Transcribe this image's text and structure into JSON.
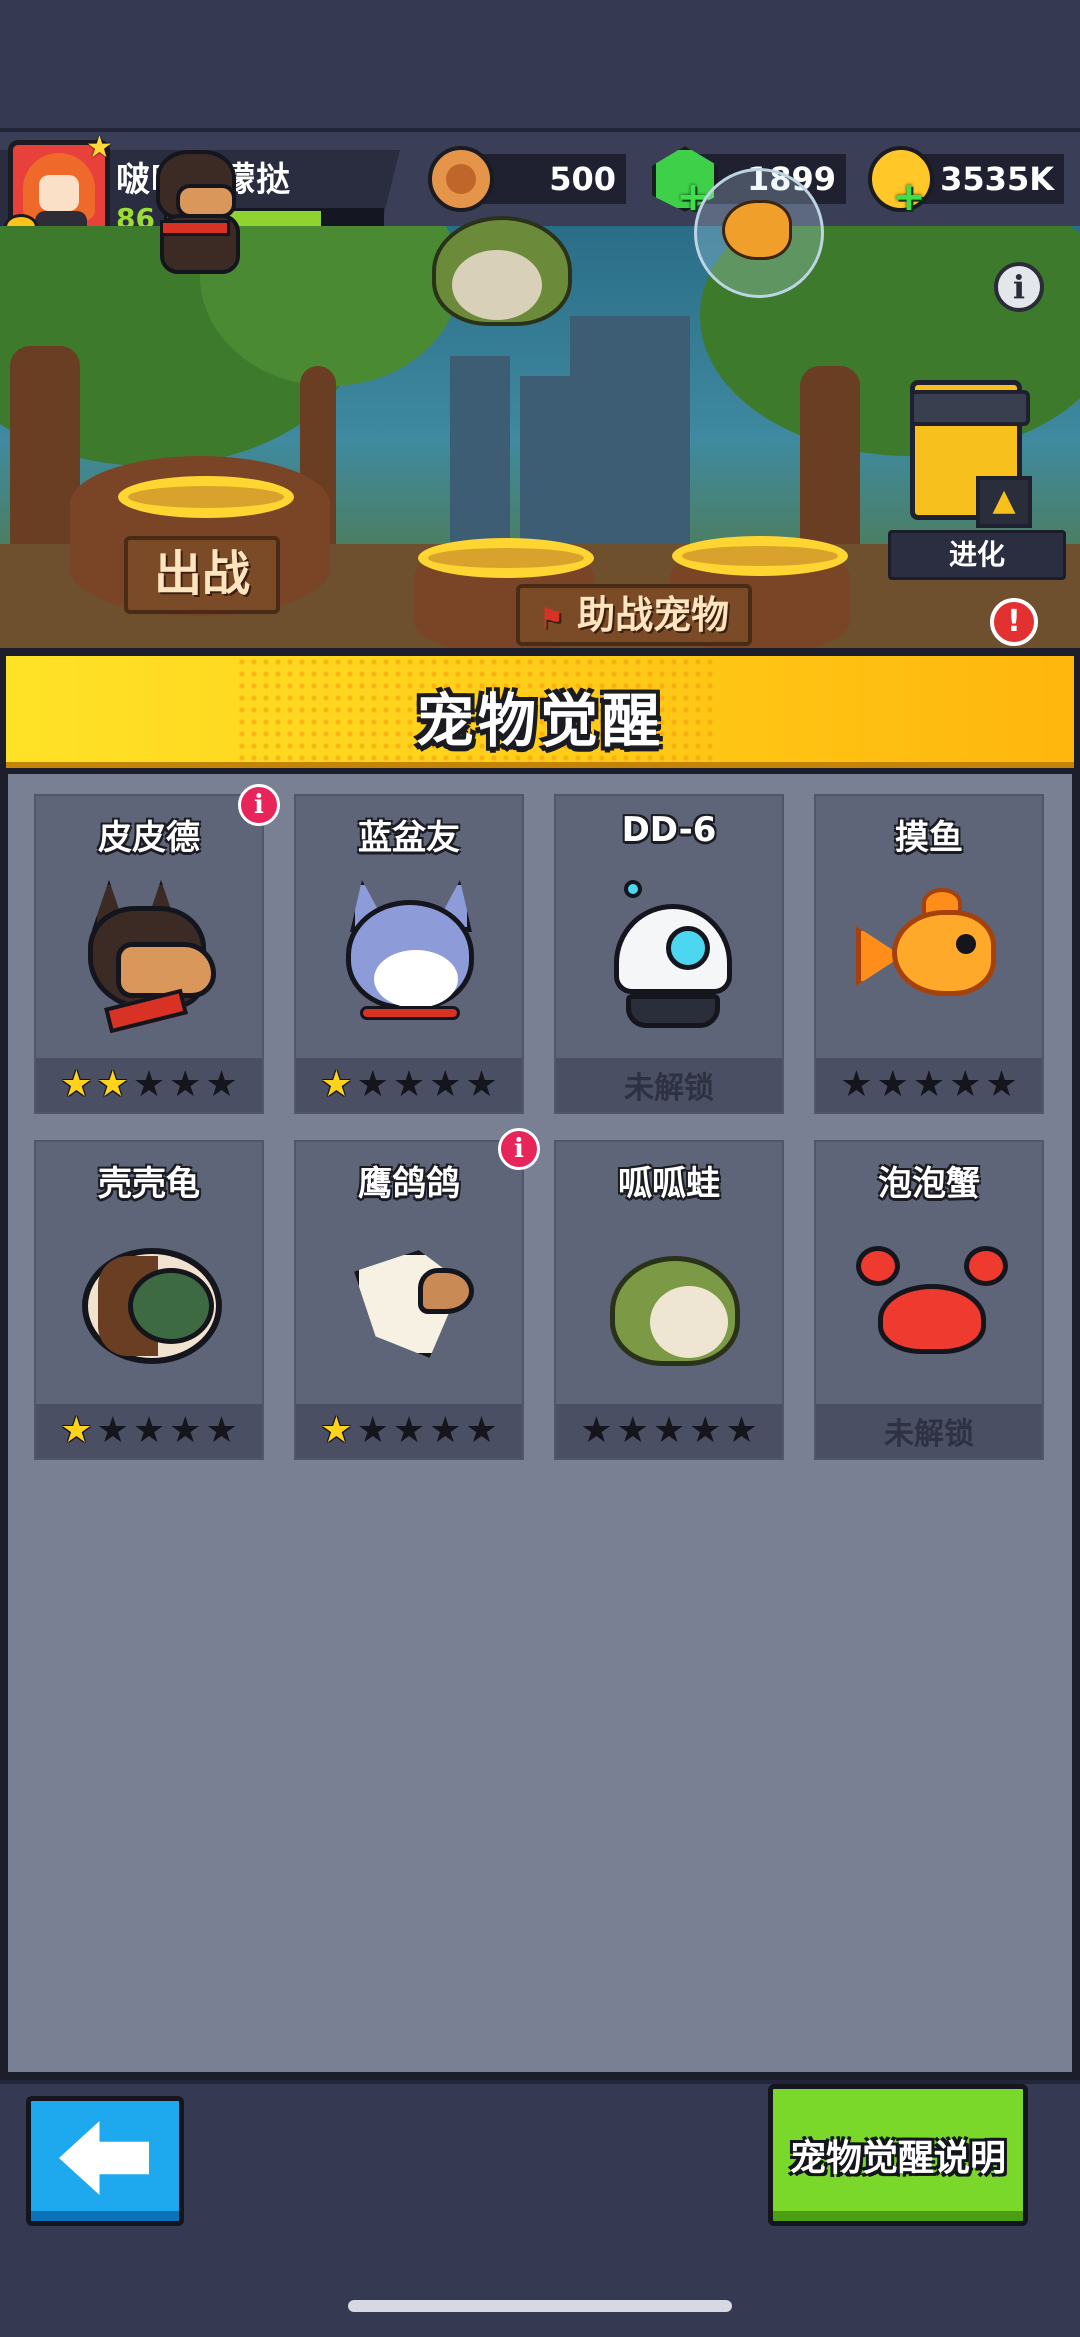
{
  "player": {
    "name": "啵啵柠檬挞",
    "level": "86",
    "xp_fraction": 0.72
  },
  "currencies": [
    {
      "id": "bread",
      "icon": "bread-coin-icon",
      "value": "500"
    },
    {
      "id": "gem",
      "icon": "green-gem-icon",
      "value": "1899"
    },
    {
      "id": "gold",
      "icon": "gold-coin-icon",
      "value": "3535K"
    }
  ],
  "scene": {
    "deploy_label": "出战",
    "assist_label": "助战宠物",
    "evolve_label": "进化",
    "alert_mark": "!",
    "info_mark": "i"
  },
  "panel": {
    "title": "宠物觉醒"
  },
  "pets": [
    {
      "name": "皮皮德",
      "art": "shepherd-dog",
      "stars": 2,
      "locked": false,
      "badge": true
    },
    {
      "name": "蓝盆友",
      "art": "blue-cat",
      "stars": 1,
      "locked": false,
      "badge": false
    },
    {
      "name": "DD-6",
      "art": "robot",
      "stars": 0,
      "locked": true,
      "badge": false
    },
    {
      "name": "摸鱼",
      "art": "goldfish",
      "stars": 0,
      "locked": false,
      "badge": false
    },
    {
      "name": "壳壳龟",
      "art": "turtle",
      "stars": 1,
      "locked": false,
      "badge": false
    },
    {
      "name": "鹰鸽鸽",
      "art": "eagle",
      "stars": 1,
      "locked": false,
      "badge": true
    },
    {
      "name": "呱呱蛙",
      "art": "frog",
      "stars": 0,
      "locked": false,
      "badge": false
    },
    {
      "name": "泡泡蟹",
      "art": "crab",
      "stars": 0,
      "locked": true,
      "badge": false
    }
  ],
  "locked_text": "未解锁",
  "badge_mark": "i",
  "star_max": 5,
  "buttons": {
    "back": "back-arrow-icon",
    "help_label": "宠物觉醒说明"
  },
  "colors": {
    "star_on": "#ffd21c",
    "star_off": "#14151d",
    "banner": "#ffd21c",
    "help_button": "#7ad82a",
    "back_button": "#1ea8ee"
  }
}
